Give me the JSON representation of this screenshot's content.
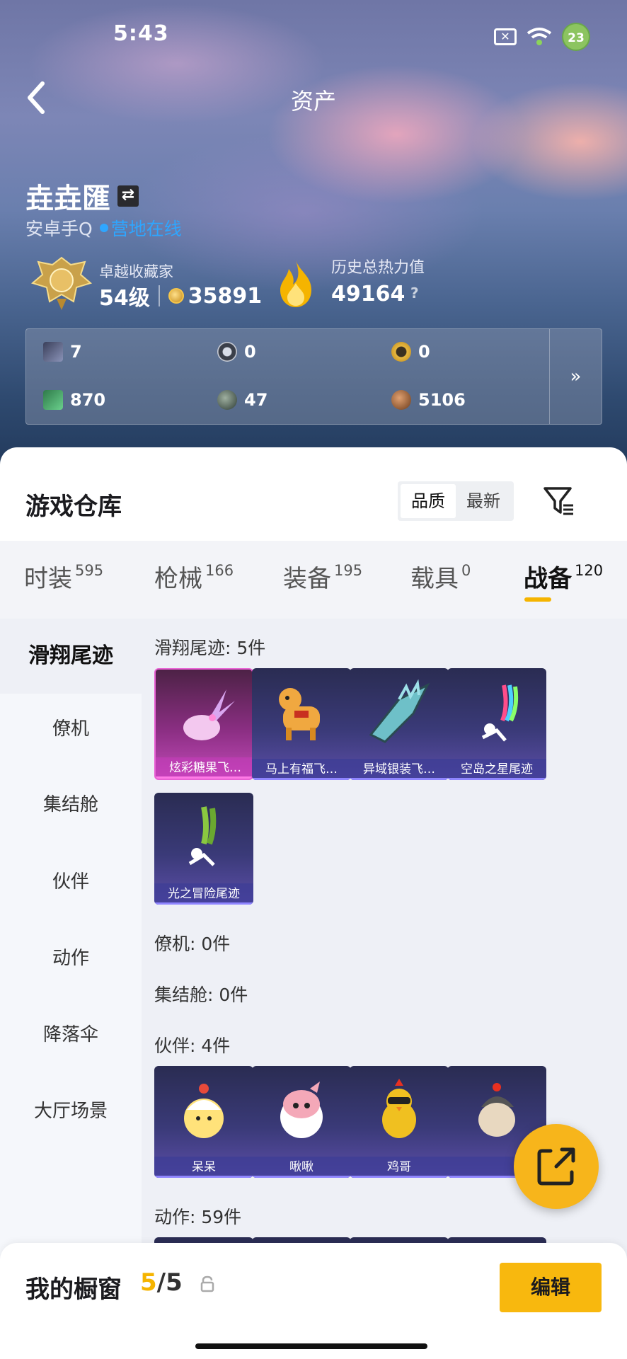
{
  "status_bar": {
    "time": "5:43",
    "battery": "23"
  },
  "nav": {
    "title": "资产"
  },
  "user": {
    "name": "垚垚匯",
    "platform": "安卓手Q",
    "status": "营地在线"
  },
  "stats": {
    "collector_title": "卓越收藏家",
    "level": "54级",
    "coins": "35891",
    "heat_label": "历史总热力值",
    "heat_value": "49164",
    "help": "?"
  },
  "currencies": [
    {
      "icon": "card-icon",
      "value": "7"
    },
    {
      "icon": "silver-coin-icon",
      "value": "0"
    },
    {
      "icon": "gold-coin-icon",
      "value": "0"
    },
    {
      "icon": "ticket-icon",
      "value": "870"
    },
    {
      "icon": "orb-icon",
      "value": "47"
    },
    {
      "icon": "bronze-coin-icon",
      "value": "5106"
    }
  ],
  "currency_more": "»",
  "warehouse": {
    "title": "游戏仓库",
    "sort_options": [
      "品质",
      "最新"
    ],
    "sort_selected": "品质"
  },
  "tabs": [
    {
      "label": "时装",
      "count": "595"
    },
    {
      "label": "枪械",
      "count": "166"
    },
    {
      "label": "装备",
      "count": "195"
    },
    {
      "label": "载具",
      "count": "0"
    },
    {
      "label": "战备",
      "count": "120"
    }
  ],
  "active_tab": "战备",
  "side_categories": [
    "滑翔尾迹",
    "僚机",
    "集结舱",
    "伙伴",
    "动作",
    "降落伞",
    "大厅场景"
  ],
  "sections": {
    "glide": {
      "title": "滑翔尾迹: 5件",
      "items": [
        "炫彩糖果飞…",
        "马上有福飞…",
        "异域银装飞…",
        "空岛之星尾迹",
        "光之冒险尾迹"
      ]
    },
    "wingman": {
      "title": "僚机: 0件"
    },
    "capsule": {
      "title": "集结舱: 0件"
    },
    "partner": {
      "title": "伙伴: 4件",
      "items": [
        "呆呆",
        "啾啾",
        "鸡哥",
        ""
      ]
    },
    "action": {
      "title": "动作: 59件"
    }
  },
  "showcase": {
    "title": "我的橱窗",
    "current": "5",
    "sep": "/",
    "total": "5",
    "edit_label": "编辑"
  },
  "colors": {
    "accent": "#f5b400",
    "online": "#2ea6ff",
    "card_rare": "#c24ab8",
    "card_base": "#3a3a78"
  }
}
